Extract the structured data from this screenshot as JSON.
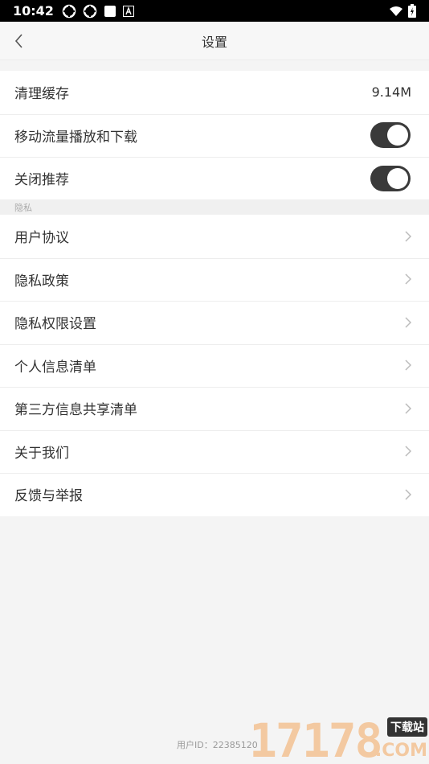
{
  "status_bar": {
    "time": "10:42"
  },
  "nav": {
    "title": "设置"
  },
  "group1": {
    "items": [
      {
        "label": "清理缓存",
        "value": "9.14M"
      },
      {
        "label": "移动流量播放和下载",
        "toggle_on": true
      },
      {
        "label": "关闭推荐",
        "toggle_on": true
      }
    ]
  },
  "section": {
    "privacy_header": "隐私"
  },
  "group2": {
    "items": [
      {
        "label": "用户协议"
      },
      {
        "label": "隐私政策"
      },
      {
        "label": "隐私权限设置"
      },
      {
        "label": "个人信息清单"
      },
      {
        "label": "第三方信息共享清单"
      },
      {
        "label": "关于我们"
      },
      {
        "label": "反馈与举报"
      }
    ]
  },
  "footer": {
    "user_id": "用户ID：22385120"
  },
  "watermark": {
    "digits": "17178",
    "tag": "下载站",
    "domain": ".COM"
  },
  "colors": {
    "toggle_on": "#3a3a3a",
    "background": "#f4f4f4"
  }
}
